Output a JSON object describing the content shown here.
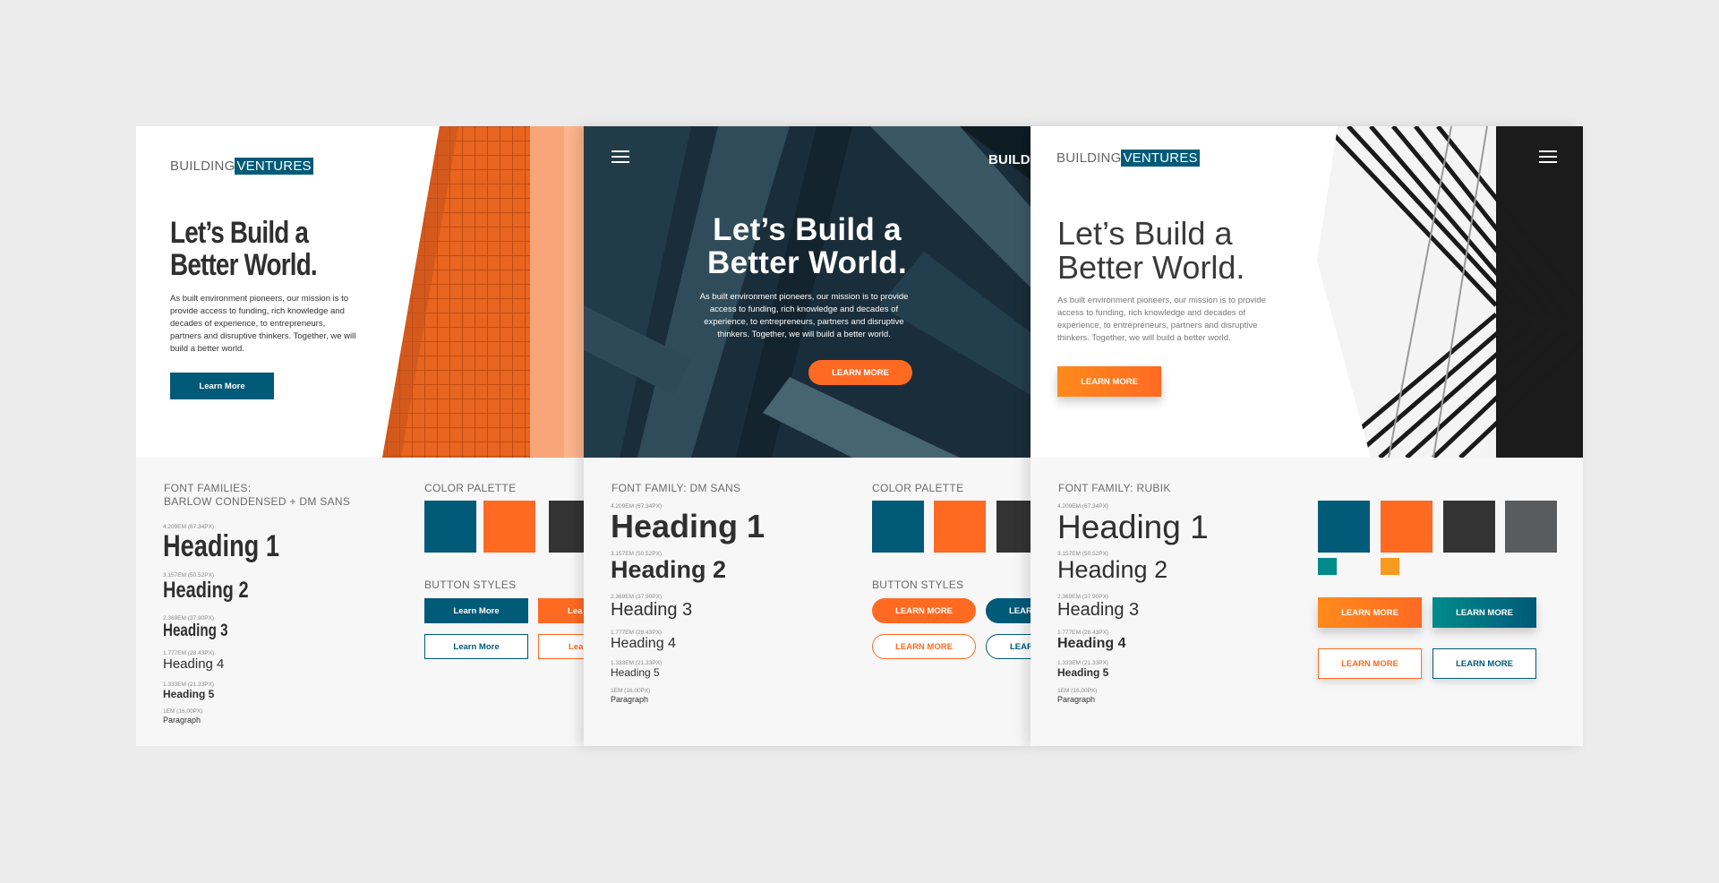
{
  "colors": {
    "blue": "#005a78",
    "orange": "#ff6a22",
    "dark": "#333333",
    "gray": "#5a5b5d",
    "teal": "#008b8b",
    "light_orange": "#f89a1f"
  },
  "brand": {
    "part1": "BUILDING",
    "part2": "VENTURES"
  },
  "hero": {
    "title_line1": "Let’s Build a",
    "title_line2": "Better World.",
    "body": "As built environment pioneers, our mission is to provide access to funding, rich knowledge and decades of experience, to entrepreneurs, partners and disruptive thinkers. Together, we will build a better world."
  },
  "cards": [
    {
      "cta": "Learn More",
      "font_label_line1": "FONT FAMILIES:",
      "font_label_line2": "BARLOW CONDENSED + DM SANS",
      "palette_label": "COLOR PALETTE",
      "buttons_label": "BUTTON STYLES",
      "btn_primary": "Learn More",
      "btn_secondary": "Learn More",
      "btn_orange_partial": "Lea",
      "btn_outline_orange_partial": "Lea"
    },
    {
      "cta": "LEARN MORE",
      "brand_partial": "BUILDI",
      "font_label": "FONT FAMILY: DM SANS",
      "palette_label": "COLOR PALETTE",
      "buttons_label": "BUTTON STYLES",
      "btn_primary": "LEARN MORE",
      "btn_secondary": "LEARN MORE",
      "btn_blue_partial": "LEAR",
      "btn_outline_blue_partial": "LEAR"
    },
    {
      "cta": "LEARN MORE",
      "font_label": "FONT FAMILY: RUBIK",
      "btn_orange": "LEARN MORE",
      "btn_teal": "LEARN MORE",
      "btn_outline_orange": "LEARN MORE",
      "btn_outline_blue": "LEARN MORE"
    }
  ],
  "type_scale": [
    {
      "size": "4.209EM (67.34PX)",
      "name": "Heading 1"
    },
    {
      "size": "3.157EM (50.52PX)",
      "name": "Heading 2"
    },
    {
      "size": "2.369EM (37.90PX)",
      "name": "Heading 3"
    },
    {
      "size": "1.777EM (28.43PX)",
      "name": "Heading 4"
    },
    {
      "size": "1.333EM (21.33PX)",
      "name": "Heading 5"
    },
    {
      "size": "1EM (16.00PX)",
      "name": "Paragraph"
    }
  ]
}
